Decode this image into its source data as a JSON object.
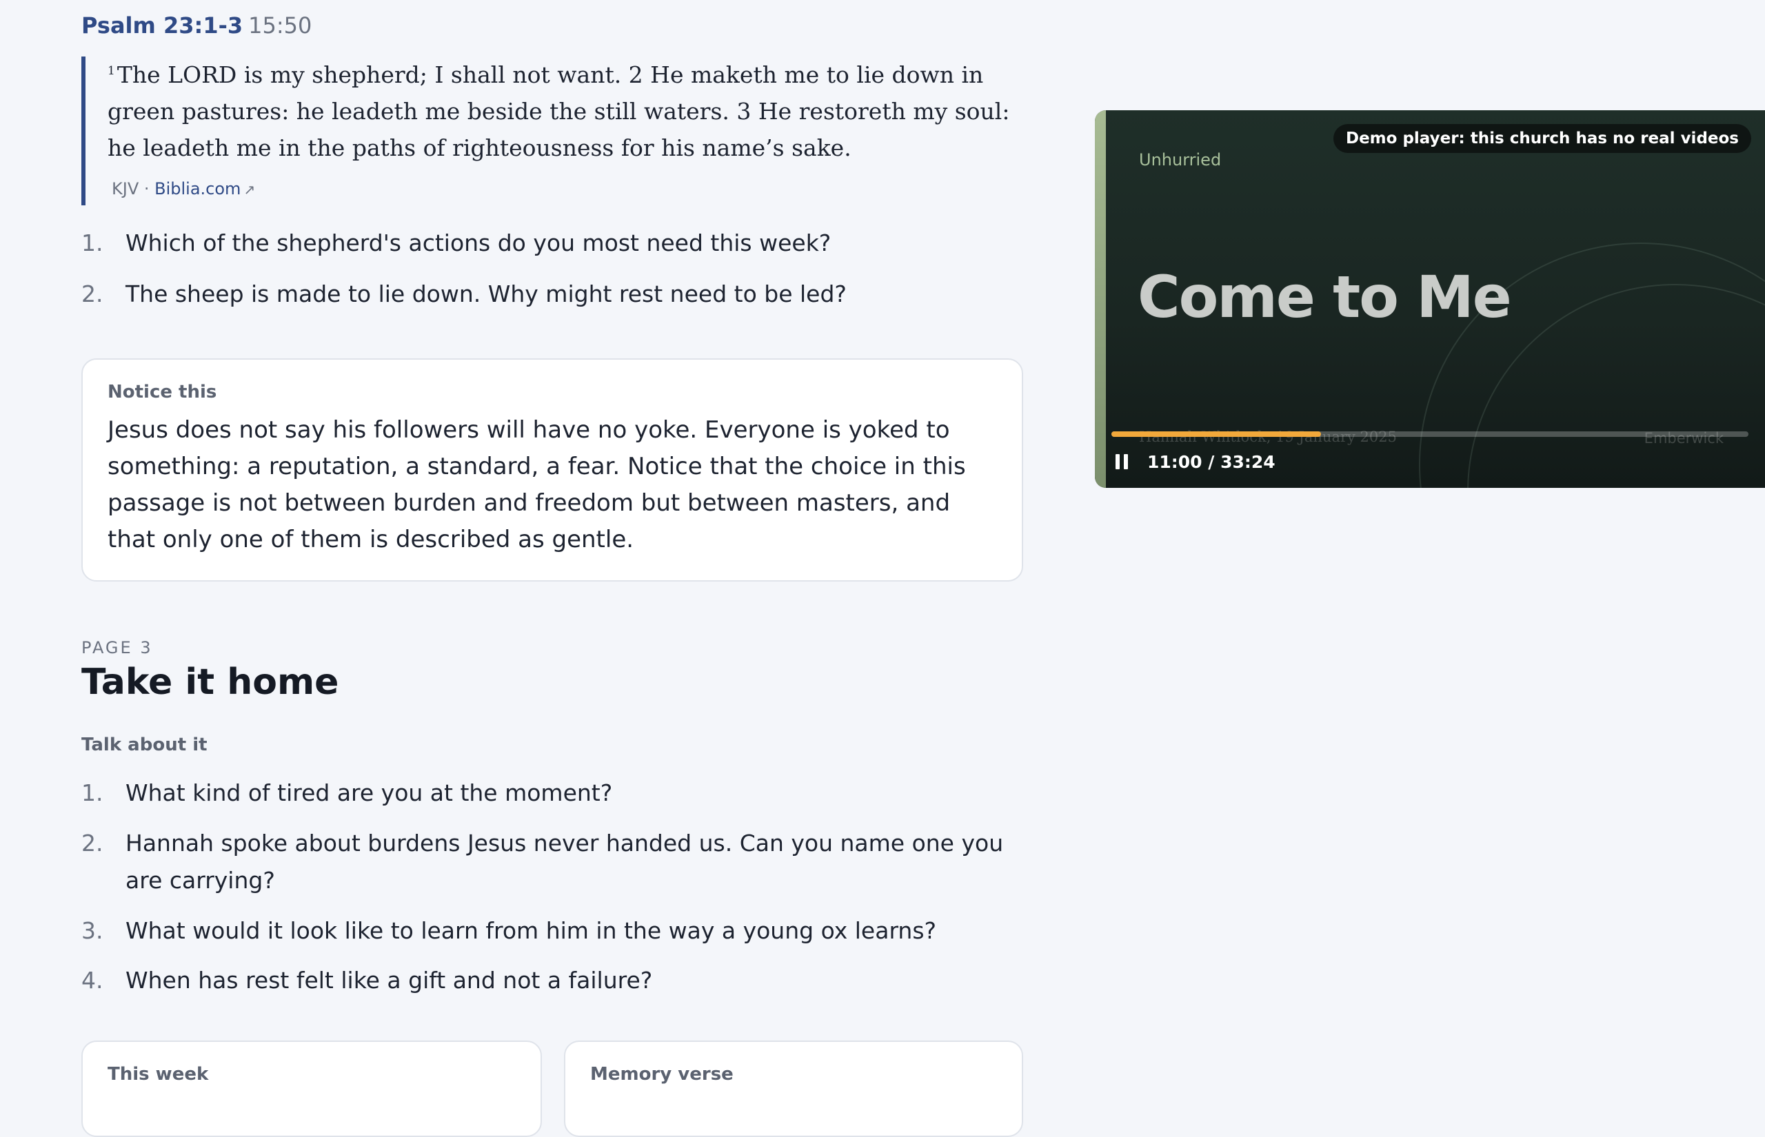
{
  "reading": {
    "reference": "Psalm 23:1-3",
    "timestamp": "15:50",
    "verse_number": "1",
    "text": "The LORD is my shepherd; I shall not want. 2 He maketh me to lie down in green pastures: he leadeth me beside the still waters. 3 He restoreth my soul: he leadeth me in the paths of righteousness for his name’s sake.",
    "translation": "KJV ·",
    "source_link": "Biblia.com",
    "external_arrow": "↗"
  },
  "reading_questions": [
    {
      "num": "1.",
      "text": "Which of the shepherd's actions do you most need this week?"
    },
    {
      "num": "2.",
      "text": "The sheep is made to lie down. Why might rest need to be led?"
    }
  ],
  "notice": {
    "label": "Notice this",
    "body": "Jesus does not say his followers will have no yoke. Everyone is yoked to something: a reputation, a standard, a fear. Notice that the choice in this passage is not between burden and freedom but between masters, and that only one of them is described as gentle."
  },
  "page3": {
    "page_label": "PAGE 3",
    "title": "Take it home",
    "talk_label": "Talk about it",
    "questions": [
      {
        "num": "1.",
        "text": "What kind of tired are you at the moment?"
      },
      {
        "num": "2.",
        "text": "Hannah spoke about burdens Jesus never handed us. Can you name one you are carrying?"
      },
      {
        "num": "3.",
        "text": "What would it look like to learn from him in the way a young ox learns?"
      },
      {
        "num": "4.",
        "text": "When has rest felt like a gift and not a failure?"
      }
    ],
    "cards": [
      {
        "label": "This week"
      },
      {
        "label": "Memory verse"
      }
    ]
  },
  "player": {
    "demo_badge": "Demo player: this church has no real videos",
    "series": "Unhurried",
    "title": "Come to Me",
    "byline": "Hannah Whitlock, 19 January 2025",
    "church": "Emberwick",
    "time": "11:00 / 33:24",
    "progress_fraction": 0.329,
    "accent_color": "#f2a93b",
    "icon": "pause-icon"
  }
}
